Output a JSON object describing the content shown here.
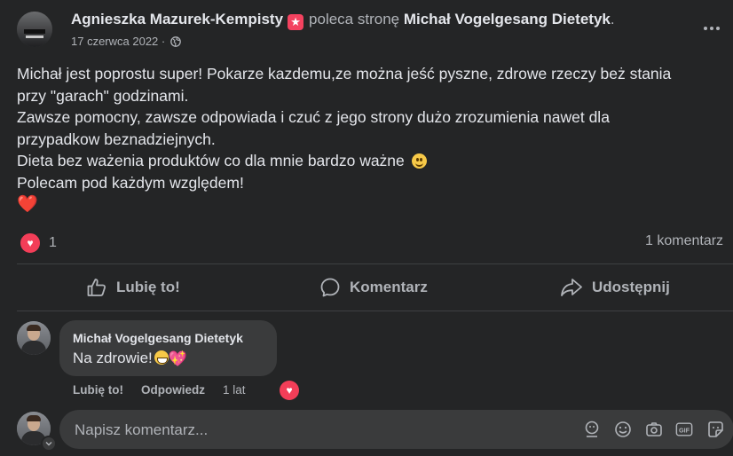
{
  "post": {
    "author": "Agnieszka Mazurek-Kempisty",
    "recommends_text": "poleca stronę",
    "page_name": "Michał Vogelgesang Dietetyk",
    "end_dot": ".",
    "date": "17 czerwca 2022",
    "date_sep": "·",
    "audience_icon": "globe-icon",
    "body_lines": [
      "Michał jest poprostu super! Pokarze kazdemu,ze można jeść pyszne, zdrowe rzeczy beż stania",
      "przy \"garach\" godzinami.",
      "Zawsze pomocny, zawsze odpowiada i czuć z jego strony dużo zrozumienia nawet dla",
      "przypadkow beznadziejnych.",
      "Dieta bez ważenia produktów co dla mnie bardzo ważne",
      "Polecam pod każdym względem!"
    ],
    "heart": "❤️",
    "reaction_count": "1",
    "comment_count": "1 komentarz"
  },
  "actions": {
    "like": "Lubię to!",
    "comment": "Komentarz",
    "share": "Udostępnij"
  },
  "comment": {
    "author": "Michał Vogelgesang Dietetyk",
    "text": "Na zdrowie!",
    "like": "Lubię to!",
    "reply": "Odpowiedz",
    "time": "1 lat"
  },
  "composer": {
    "placeholder": "Napisz komentarz..."
  },
  "colors": {
    "background": "#242526",
    "bubble": "#3a3b3c",
    "text_primary": "#e4e6eb",
    "text_secondary": "#b0b3b8",
    "love": "#f33e58"
  }
}
